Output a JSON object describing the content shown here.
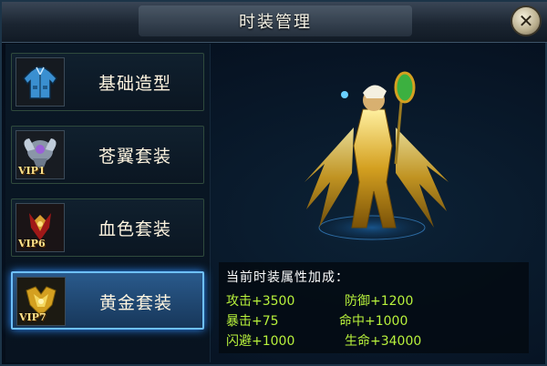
{
  "window": {
    "title": "时装管理",
    "close_icon": "close-icon"
  },
  "outfits": [
    {
      "label": "基础造型",
      "vip": "",
      "icon": "jacket-icon",
      "selected": false
    },
    {
      "label": "苍翼套装",
      "vip": "VIP1",
      "icon": "winged-armor-icon",
      "selected": false
    },
    {
      "label": "血色套装",
      "vip": "VIP6",
      "icon": "crimson-armor-icon",
      "selected": false
    },
    {
      "label": "黄金套装",
      "vip": "VIP7",
      "icon": "golden-armor-icon",
      "selected": true
    }
  ],
  "preview": {
    "character": "golden-armor-character"
  },
  "stats": {
    "title": "当前时装属性加成：",
    "items": [
      {
        "text": "攻击+3500"
      },
      {
        "text": "防御+1200"
      },
      {
        "text": "暴击+75"
      },
      {
        "text": "命中+1000"
      },
      {
        "text": "闪避+1000"
      },
      {
        "text": "生命+34000"
      }
    ]
  },
  "colors": {
    "stat_text": "#b8f23c",
    "selected_border": "#6ec0ff",
    "gold": "#d4a020"
  }
}
